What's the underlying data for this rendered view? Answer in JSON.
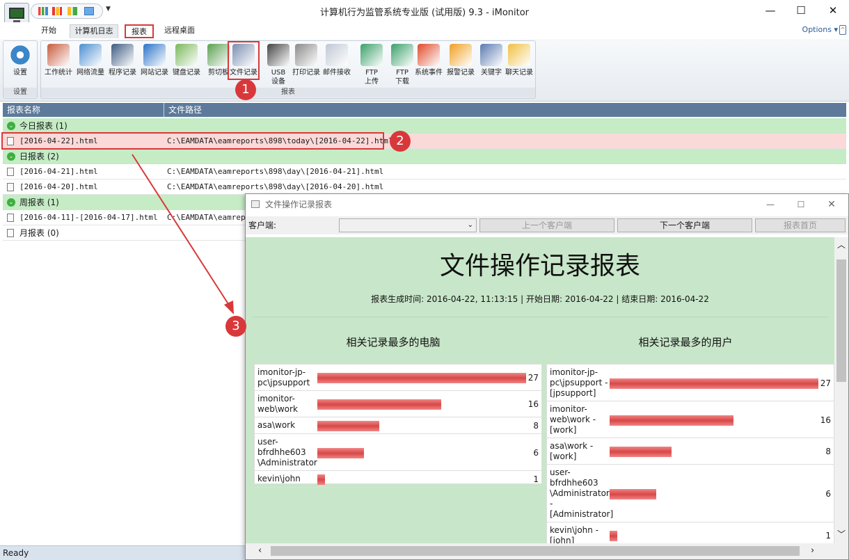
{
  "window": {
    "title": "计算机行为监管系统专业版 (试用版) 9.3 - iMonitor",
    "minimize": "—",
    "maximize": "☐",
    "close": "✕"
  },
  "tabs": [
    "开始",
    "计算机日志",
    "报表",
    "远程桌面"
  ],
  "options_label": "Options ▾",
  "ribbon": {
    "settings_group": {
      "button": "设置",
      "label": "设置"
    },
    "report_group_label": "报表",
    "buttons": [
      {
        "label": "工作统计",
        "icon": "work-stats-icon",
        "color": "#c85a3c"
      },
      {
        "label": "网络流量",
        "icon": "network-traffic-icon",
        "color": "#4a8fd0"
      },
      {
        "label": "程序记录",
        "icon": "program-icon",
        "color": "#3d5a80"
      },
      {
        "label": "网站记录",
        "icon": "globe-icon",
        "color": "#2a73c8"
      },
      {
        "label": "键盘记录",
        "icon": "keyboard-icon",
        "color": "#7ab85a"
      },
      {
        "label": "剪切板",
        "icon": "clipboard-icon",
        "color": "#5aa050"
      },
      {
        "label": "文件记录",
        "icon": "file-record-icon",
        "color": "#7a8fb0"
      },
      {
        "label": "USB\n设备",
        "icon": "usb-icon",
        "color": "#444444"
      },
      {
        "label": "打印记录",
        "icon": "printer-icon",
        "color": "#8a8a8a"
      },
      {
        "label": "邮件接收",
        "icon": "mail-icon",
        "color": "#c0c8d4"
      },
      {
        "label": "FTP\n上传",
        "icon": "ftp-upload-icon",
        "color": "#3aa06a"
      },
      {
        "label": "FTP\n下载",
        "icon": "ftp-download-icon",
        "color": "#3aa06a"
      },
      {
        "label": "系统事件",
        "icon": "windows-icon",
        "color": "#e04a2a"
      },
      {
        "label": "报警记录",
        "icon": "warning-icon",
        "color": "#f0a020"
      },
      {
        "label": "关键字",
        "icon": "keyword-icon",
        "color": "#5a7ab0"
      },
      {
        "label": "聊天记录",
        "icon": "chat-icon",
        "color": "#f0c040"
      }
    ]
  },
  "annotations": [
    "1",
    "2",
    "3"
  ],
  "list": {
    "headers": [
      "报表名称",
      "文件路径"
    ],
    "groups": [
      {
        "label": "今日报表 (1)",
        "rows": [
          {
            "name": "[2016-04-22].html",
            "path": "C:\\EAMDATA\\eamreports\\898\\today\\[2016-04-22].html"
          }
        ]
      },
      {
        "label": "日报表 (2)",
        "rows": [
          {
            "name": "[2016-04-21].html",
            "path": "C:\\EAMDATA\\eamreports\\898\\day\\[2016-04-21].html"
          },
          {
            "name": "[2016-04-20].html",
            "path": "C:\\EAMDATA\\eamreports\\898\\day\\[2016-04-20].html"
          }
        ]
      },
      {
        "label": "周报表 (1)",
        "rows": [
          {
            "name": "[2016-04-11]-[2016-04-17].html",
            "path": "C:\\EAMDATA\\eamreport"
          }
        ]
      },
      {
        "label": "月报表 (0)",
        "rows": []
      }
    ]
  },
  "status": "Ready",
  "report_window": {
    "title": "文件操作记录报表",
    "client_label": "客户端:",
    "prev_client": "上一个客户端",
    "next_client": "下一个客户端",
    "home": "报表首页",
    "heading": "文件操作记录报表",
    "info": "报表生成时间: 2016-04-22, 11:13:15 | 开始日期: 2016-04-22 | 结束日期: 2016-04-22",
    "computers_title": "相关记录最多的电脑",
    "users_title": "相关记录最多的用户",
    "computers": [
      {
        "name": "imonitor-jp-\npc\\jpsupport",
        "value": 27
      },
      {
        "name": "imonitor-\nweb\\work",
        "value": 16
      },
      {
        "name": "asa\\work",
        "value": 8
      },
      {
        "name": "user-\nbfrdhhe603\n\\Administrator",
        "value": 6
      },
      {
        "name": "kevin\\john",
        "value": 1
      }
    ],
    "users": [
      {
        "name": "imonitor-jp-\npc\\jpsupport -\n[jpsupport]",
        "value": 27
      },
      {
        "name": "imonitor-\nweb\\work -\n[work]",
        "value": 16
      },
      {
        "name": "asa\\work -\n[work]",
        "value": 8
      },
      {
        "name": "user-\nbfrdhhe603\n\\Administrator\n-\n[Administrator]",
        "value": 6
      },
      {
        "name": "kevin\\john -\n[john]",
        "value": 1
      }
    ],
    "max_value": 27
  }
}
